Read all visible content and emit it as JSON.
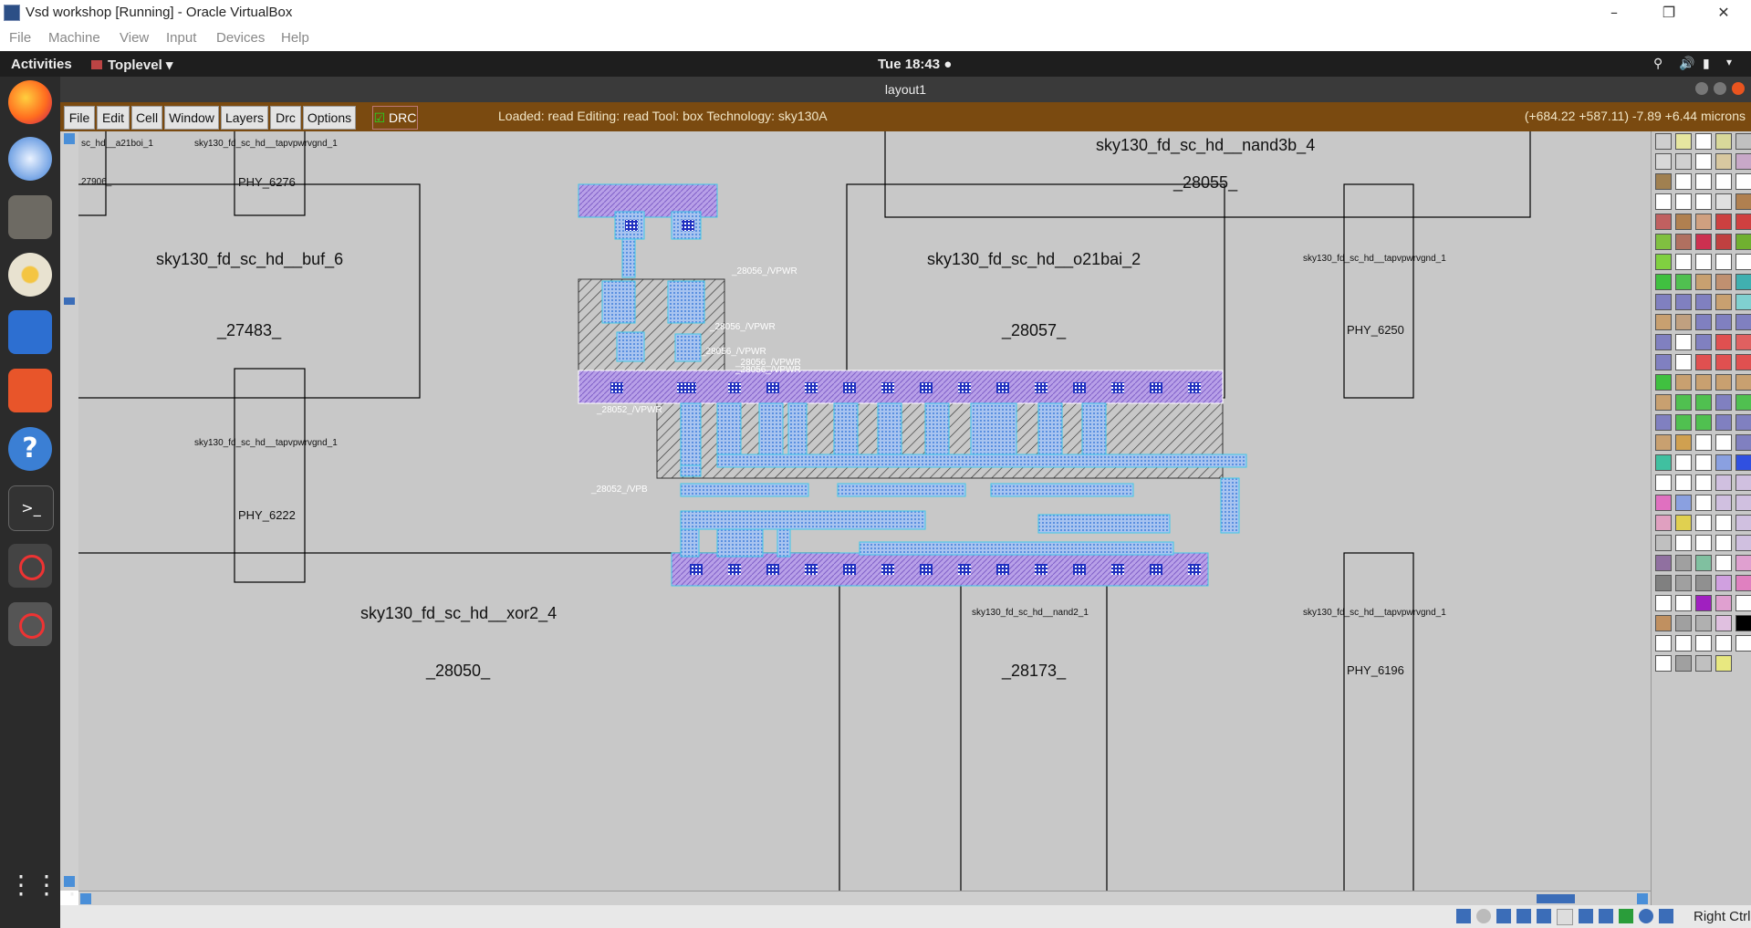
{
  "host": {
    "title": "Vsd workshop [Running] - Oracle VirtualBox",
    "menu": [
      "File",
      "Machine",
      "View",
      "Input",
      "Devices",
      "Help"
    ],
    "right_ctrl": "Right Ctrl"
  },
  "topbar": {
    "activities": "Activities",
    "app": "Toplevel",
    "clock": "Tue 18:43"
  },
  "magic": {
    "window_title": "layout1",
    "menu": [
      "File",
      "Edit",
      "Cell",
      "Window",
      "Layers",
      "Drc",
      "Options"
    ],
    "drc_label": "DRC",
    "status": "Loaded: read  Editing: read  Tool: box   Technology: sky130A",
    "coords": "(+684.22 +587.11) -7.89 +6.44 microns"
  },
  "cells": {
    "a21boi_name": "sc_hd__a21boi_1",
    "a21boi_id": "27906_",
    "tap1_name": "sky130_fd_sc_hd__tapvpwrvgnd_1",
    "tap1_id": "PHY_6276",
    "nand3b_name": "sky130_fd_sc_hd__nand3b_4",
    "nand3b_id": "_28055_",
    "buf6_name": "sky130_fd_sc_hd__buf_6",
    "buf6_id": "_27483_",
    "o21bai_name": "sky130_fd_sc_hd__o21bai_2",
    "o21bai_id": "_28057_",
    "tap2_name": "sky130_fd_sc_hd__tapvpwrvgnd_1",
    "tap2_id": "PHY_6250",
    "tap3_name": "sky130_fd_sc_hd__tapvpwrvgnd_1",
    "tap3_id": "PHY_6222",
    "xor2_name": "sky130_fd_sc_hd__xor2_4",
    "xor2_id": "_28050_",
    "nand2_name": "sky130_fd_sc_hd__nand2_1",
    "nand2_id": "_28173_",
    "tap4_name": "sky130_fd_sc_hd__tapvpwrvgnd_1",
    "tap4_id": "PHY_6196"
  },
  "nets": {
    "n1": "_28056_/VPWR",
    "n2": "_28056_/VPWR",
    "n3": "_28056_/VPWR",
    "n4": "_28056_/VPWR",
    "n5": "_28056_/VPWR",
    "n6": "_28052_/VPWR",
    "n7": "_28052_/VPB"
  }
}
